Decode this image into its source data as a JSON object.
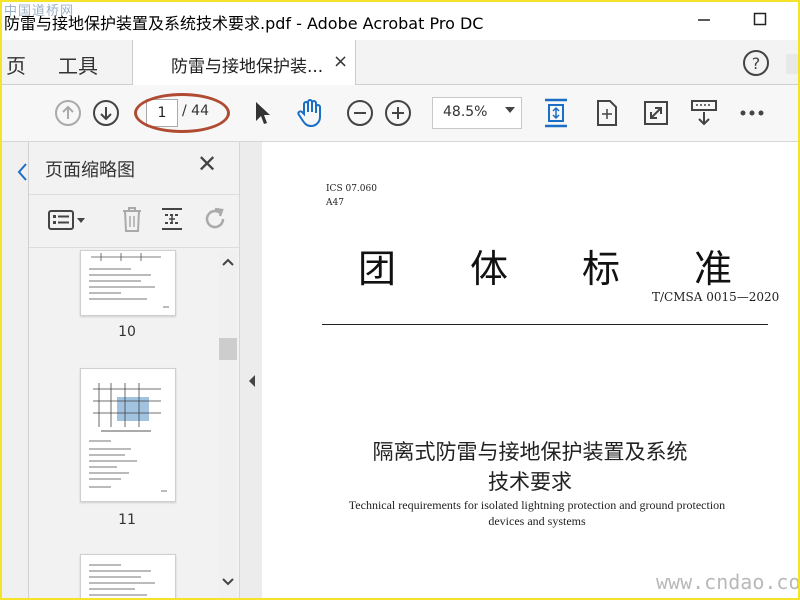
{
  "window": {
    "title": "防雷与接地保护装置及系统技术要求.pdf - Adobe Acrobat Pro DC",
    "watermark": "中国道桥网"
  },
  "menu": {
    "home": "页",
    "tools": "工具"
  },
  "tab": {
    "label": "防雷与接地保护装...",
    "close": "×"
  },
  "toolbar": {
    "page_current": "1",
    "page_total": "/ 44",
    "zoom": "48.5%"
  },
  "thumbnails": {
    "title": "页面缩略图",
    "close": "✕",
    "pages": [
      "10",
      "11"
    ]
  },
  "document": {
    "ics": "ICS 07.060",
    "a": "A47",
    "heading": [
      "团",
      "体",
      "标",
      "准"
    ],
    "standard_no": "T/CMSA 0015—2020",
    "title_cn_1": "隔离式防雷与接地保护装置及系统",
    "title_cn_2": "技术要求",
    "title_en_1": "Technical requirements for isolated lightning protection and ground protection",
    "title_en_2": "devices and systems"
  },
  "footer_watermark": "www.cndao.com",
  "colors": {
    "accent_blue": "#1a6fc4",
    "ring": "#b04a30",
    "border_yellow": "#f5e32a"
  }
}
